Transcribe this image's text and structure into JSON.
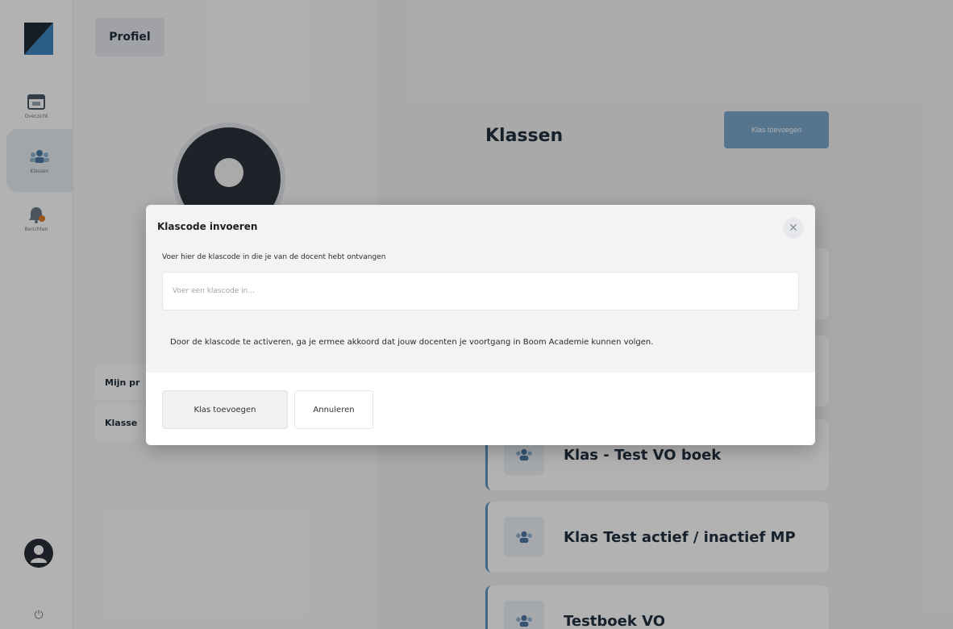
{
  "sidebar": {
    "items": [
      {
        "label": "Overzicht",
        "icon": "calendar-icon"
      },
      {
        "label": "Klassen",
        "icon": "users-icon"
      },
      {
        "label": "Berichten",
        "icon": "bell-icon",
        "badge": "0"
      }
    ],
    "active_item": "Klassen"
  },
  "profile": {
    "tab_label": "Profiel",
    "menu": [
      {
        "label": "Mijn pr"
      },
      {
        "label": "Klasse"
      }
    ]
  },
  "classes": {
    "title": "Klassen",
    "add_button": "Klas toevoegen",
    "items": [
      {
        "name": "Klas - Test VO boek"
      },
      {
        "name": "Klas Test actief / inactief MP"
      },
      {
        "name": "Testboek VO"
      }
    ]
  },
  "modal": {
    "title": "Klascode invoeren",
    "instruction": "Voer hier de klascode in die je van de docent hebt ontvangen",
    "input_placeholder": "Voer een klascode in...",
    "input_value": "",
    "consent_text": "Door de klascode te activeren, ga je ermee akkoord dat jouw docenten je voortgang in Boom Academie kunnen volgen.",
    "submit_label": "Klas toevoegen",
    "cancel_label": "Annuleren"
  },
  "colors": {
    "accent": "#7aa6cc",
    "card_accent": "#5d95c0",
    "dark_text": "#21303f",
    "overlay": "rgba(0,0,0,0.30)"
  }
}
